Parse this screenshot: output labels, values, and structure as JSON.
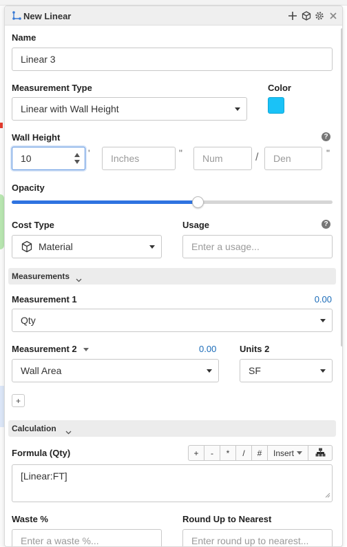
{
  "panel": {
    "title": "New Linear"
  },
  "name": {
    "label": "Name",
    "value": "Linear 3"
  },
  "measurement_type": {
    "label": "Measurement Type",
    "value": "Linear with Wall Height"
  },
  "color": {
    "label": "Color",
    "swatch": "#1ac2f7"
  },
  "wall_height": {
    "label": "Wall Height",
    "feet": "10",
    "feet_mark": "'",
    "inches_placeholder": "Inches",
    "inches_mark": "\"",
    "num_placeholder": "Num",
    "slash": "/",
    "den_placeholder": "Den",
    "den_mark": "\""
  },
  "opacity": {
    "label": "Opacity",
    "level": 0.58
  },
  "cost_type": {
    "label": "Cost Type",
    "value": "Material"
  },
  "usage": {
    "label": "Usage",
    "placeholder": "Enter a usage..."
  },
  "sections": {
    "measurements": "Measurements",
    "calculation": "Calculation"
  },
  "measurement1": {
    "label": "Measurement 1",
    "amount": "0.00",
    "value": "Qty"
  },
  "measurement2": {
    "label": "Measurement 2",
    "amount": "0.00",
    "value": "Wall Area"
  },
  "units2": {
    "label": "Units 2",
    "value": "SF"
  },
  "add_label": "+",
  "formula": {
    "label": "Formula (Qty)",
    "buttons": [
      "+",
      "-",
      "*",
      "/",
      "#"
    ],
    "insert_label": "Insert",
    "value": "[Linear:FT]"
  },
  "waste": {
    "label": "Waste %",
    "placeholder": "Enter a waste %..."
  },
  "round_up": {
    "label": "Round Up to Nearest",
    "placeholder": "Enter round up to nearest..."
  },
  "colors": {
    "accent": "#2f73e0",
    "link": "#1a6bb8"
  }
}
